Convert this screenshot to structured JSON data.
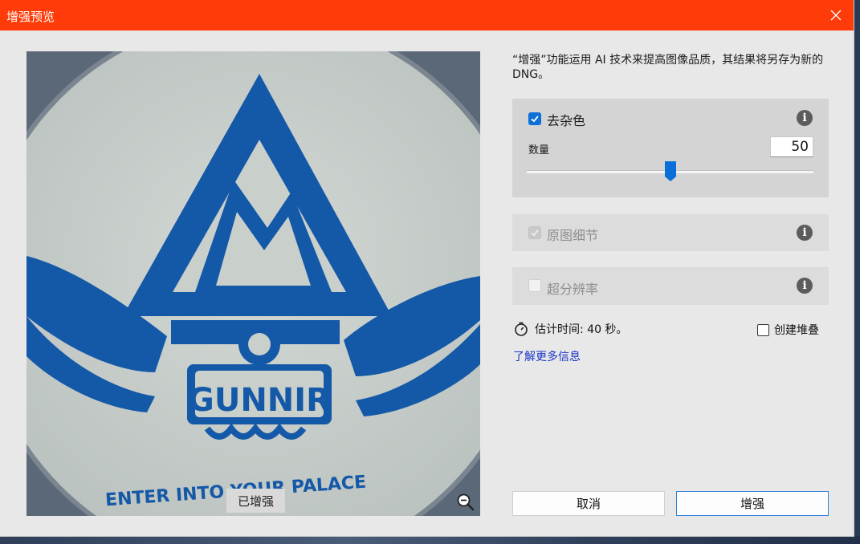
{
  "window": {
    "title": "增强预览"
  },
  "preview": {
    "badge": "已增强",
    "artwork": {
      "logo_word": "GUNNIR",
      "ring_text_left": "ENTER INTO YOUR PALACE",
      "colors": {
        "ink": "#1458a8",
        "disc": "#c9cfcb",
        "background": "#5e6a78"
      }
    }
  },
  "description": "“增强”功能运用 AI 技术来提高图像品质，其结果将另存为新的 DNG。",
  "options": {
    "denoise": {
      "label": "去杂色",
      "checked": true,
      "amount_label": "数量",
      "amount_value": "50",
      "amount_fraction": 0.5
    },
    "raw_details": {
      "label": "原图细节",
      "checked": true,
      "disabled": true
    },
    "super_resolution": {
      "label": "超分辨率",
      "checked": false,
      "disabled": true
    }
  },
  "estimate": {
    "text": "估计时间: 40 秒。"
  },
  "create_stack": {
    "label": "创建堆叠",
    "checked": false
  },
  "learn_more": "了解更多信息",
  "buttons": {
    "cancel": "取消",
    "enhance": "增强"
  },
  "icons": [
    "close-icon",
    "info-icon",
    "stopwatch-icon",
    "zoom-out-icon",
    "checkmark-icon"
  ],
  "colors": {
    "titlebar": "#ff3b09",
    "accent": "#0a6fd6",
    "link": "#1a37c8"
  }
}
